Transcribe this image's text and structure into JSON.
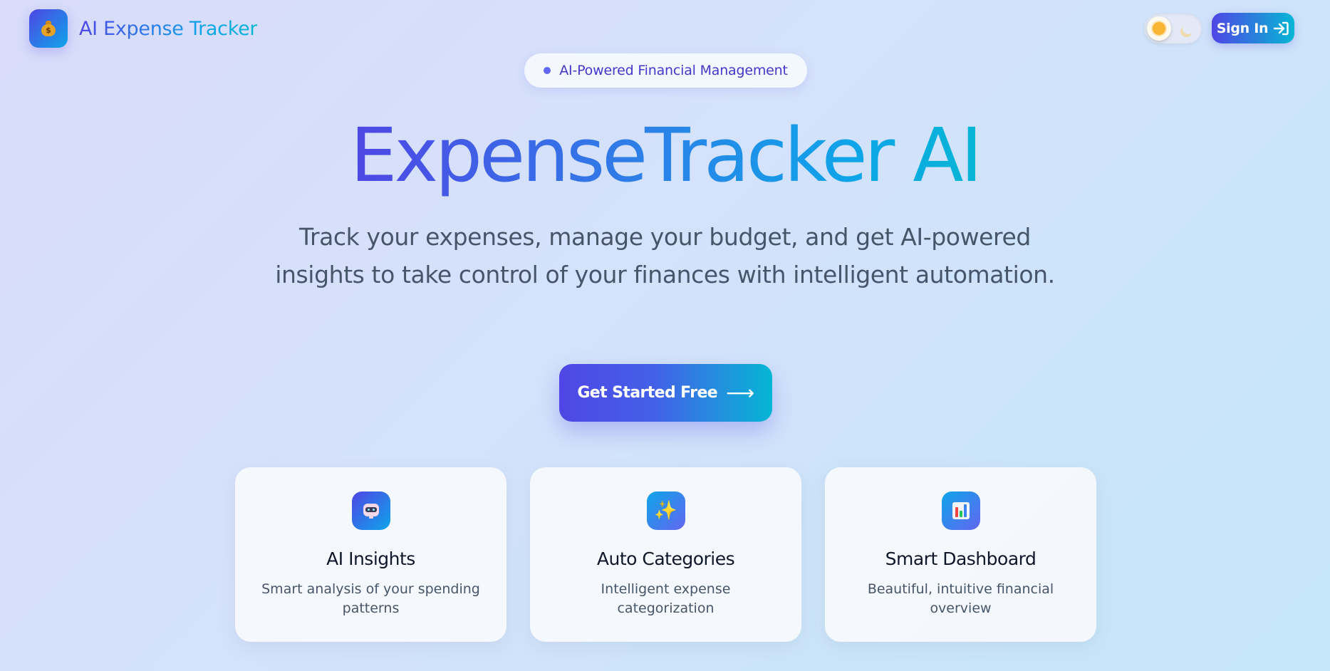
{
  "header": {
    "brand_name": "AI Expense Tracker",
    "logo_icon": "money-bag-icon",
    "theme_toggle": {
      "state": "light",
      "icons": [
        "sun-icon",
        "moon-icon"
      ]
    },
    "signin_label": "Sign In",
    "signin_icon": "sign-in-arrow-icon"
  },
  "badge": {
    "text": "AI-Powered Financial Management"
  },
  "hero": {
    "title": "ExpenseTracker AI",
    "subtitle": "Track your expenses, manage your budget, and get AI-powered insights to take control of your finances with intelligent automation.",
    "cta_label": "Get Started Free",
    "cta_arrow": "⟶"
  },
  "features": [
    {
      "icon": "robot-icon",
      "title": "AI Insights",
      "description": "Smart analysis of your spending patterns"
    },
    {
      "icon": "sparkles-icon",
      "title": "Auto Categories",
      "description": "Intelligent expense categorization"
    },
    {
      "icon": "bar-chart-icon",
      "title": "Smart Dashboard",
      "description": "Beautiful, intuitive financial overview"
    }
  ],
  "colors": {
    "primary": "#4f46e5",
    "accent": "#06b6d4",
    "text_muted": "#475569",
    "heading": "#0f172a"
  }
}
